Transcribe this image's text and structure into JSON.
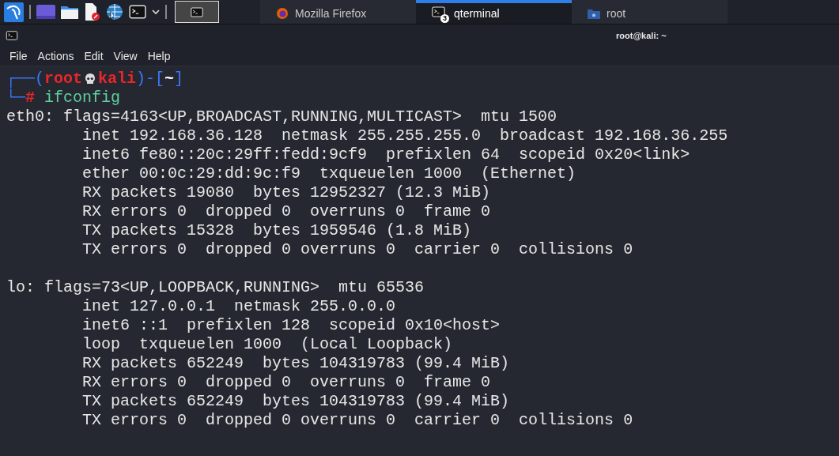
{
  "taskbar": {
    "workspaces": [
      {
        "selected": true
      }
    ],
    "tasks": [
      {
        "label": "Mozilla Firefox",
        "kind": "browser",
        "selected": false
      },
      {
        "label": "qterminal",
        "kind": "terminal",
        "selected": true,
        "badge_count": "3"
      },
      {
        "label": "root",
        "kind": "folder",
        "selected": false
      }
    ]
  },
  "window": {
    "title": "root@kali: ~"
  },
  "menu": [
    "File",
    "Actions",
    "Edit",
    "View",
    "Help"
  ],
  "prompt": [
    [
      {
        "text": "┌──(",
        "kind": "frame"
      },
      {
        "text": "root",
        "kind": "user"
      },
      {
        "kind": "skull"
      },
      {
        "text": "kali",
        "kind": "user"
      },
      {
        "text": ")-[",
        "kind": "frame"
      },
      {
        "text": "~",
        "kind": "dir"
      },
      {
        "text": "]",
        "kind": "frame"
      }
    ],
    [
      {
        "text": "└─",
        "kind": "frame"
      },
      {
        "text": "#",
        "kind": "user"
      },
      {
        "text": " ifconfig",
        "kind": "command"
      }
    ]
  ],
  "output": [
    {
      "lines": [
        "eth0: flags=4163<UP,BROADCAST,RUNNING,MULTICAST>  mtu 1500",
        "        inet 192.168.36.128  netmask 255.255.255.0  broadcast 192.168.36.255",
        "        inet6 fe80::20c:29ff:fedd:9cf9  prefixlen 64  scopeid 0x20<link>",
        "        ether 00:0c:29:dd:9c:f9  txqueuelen 1000  (Ethernet)",
        "        RX packets 19080  bytes 12952327 (12.3 MiB)",
        "        RX errors 0  dropped 0  overruns 0  frame 0",
        "        TX packets 15328  bytes 1959546 (1.8 MiB)",
        "        TX errors 0  dropped 0 overruns 0  carrier 0  collisions 0"
      ]
    },
    {
      "lines": [
        "lo: flags=73<UP,LOOPBACK,RUNNING>  mtu 65536",
        "        inet 127.0.0.1  netmask 255.0.0.0",
        "        inet6 ::1  prefixlen 128  scopeid 0x10<host>",
        "        loop  txqueuelen 1000  (Local Loopback)",
        "        RX packets 652249  bytes 104319783 (99.4 MiB)",
        "        RX errors 0  dropped 0  overruns 0  frame 0",
        "        TX packets 652249  bytes 104319783 (99.4 MiB)",
        "        TX errors 0  dropped 0 overruns 0  carrier 0  collisions 0"
      ]
    }
  ]
}
